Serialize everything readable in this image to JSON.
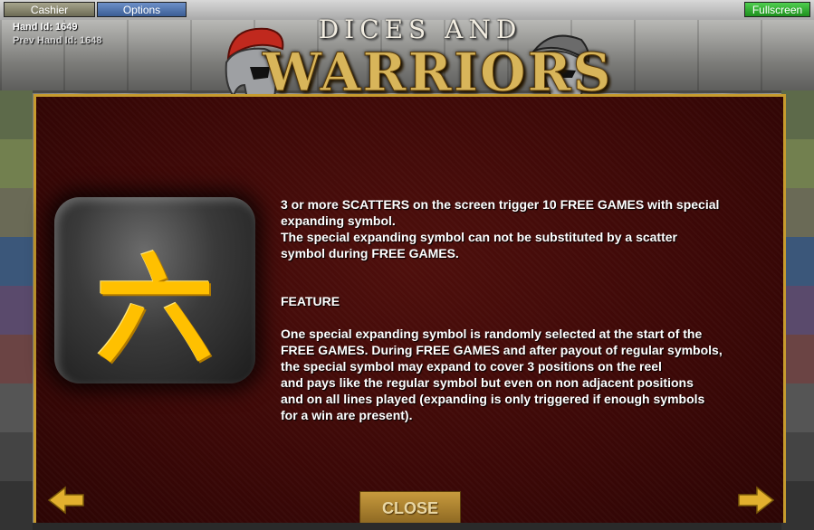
{
  "toolbar": {
    "cashier_label": "Cashier",
    "options_label": "Options",
    "fullscreen_label": "Fullscreen"
  },
  "hand_info": {
    "hand_id": "Hand Id: 1649",
    "prev_hand_id": "Prev Hand Id: 1648"
  },
  "logo": {
    "line1": "DICES AND",
    "line2": "WARRIORS"
  },
  "help_page": {
    "symbol_glyph": "六",
    "paragraph1": "3 or more SCATTERS on the screen trigger 10 FREE GAMES with special\nexpanding symbol.\nThe special expanding symbol can not be substituted by a scatter\nsymbol during FREE GAMES.",
    "feature_heading": "FEATURE",
    "paragraph2": "One special expanding symbol is randomly selected at the start of the\nFREE GAMES. During FREE GAMES and after payout of regular symbols,\nthe special symbol may expand to cover 3 positions on the reel\nand pays like the regular symbol but even on non adjacent positions\nand on all lines played (expanding is only triggered if enough symbols\nfor a win are present)."
  },
  "navigation": {
    "prev_icon": "arrow-left-icon",
    "next_icon": "arrow-right-icon",
    "close_label": "CLOSE"
  },
  "colors": {
    "panel_border": "#c79b2e",
    "panel_bg": "#3b0807",
    "symbol_color": "#ffc000",
    "arrow_color": "#e2b02e",
    "fullscreen_bg": "#1d8f1d",
    "options_bg": "#3b5e95"
  }
}
